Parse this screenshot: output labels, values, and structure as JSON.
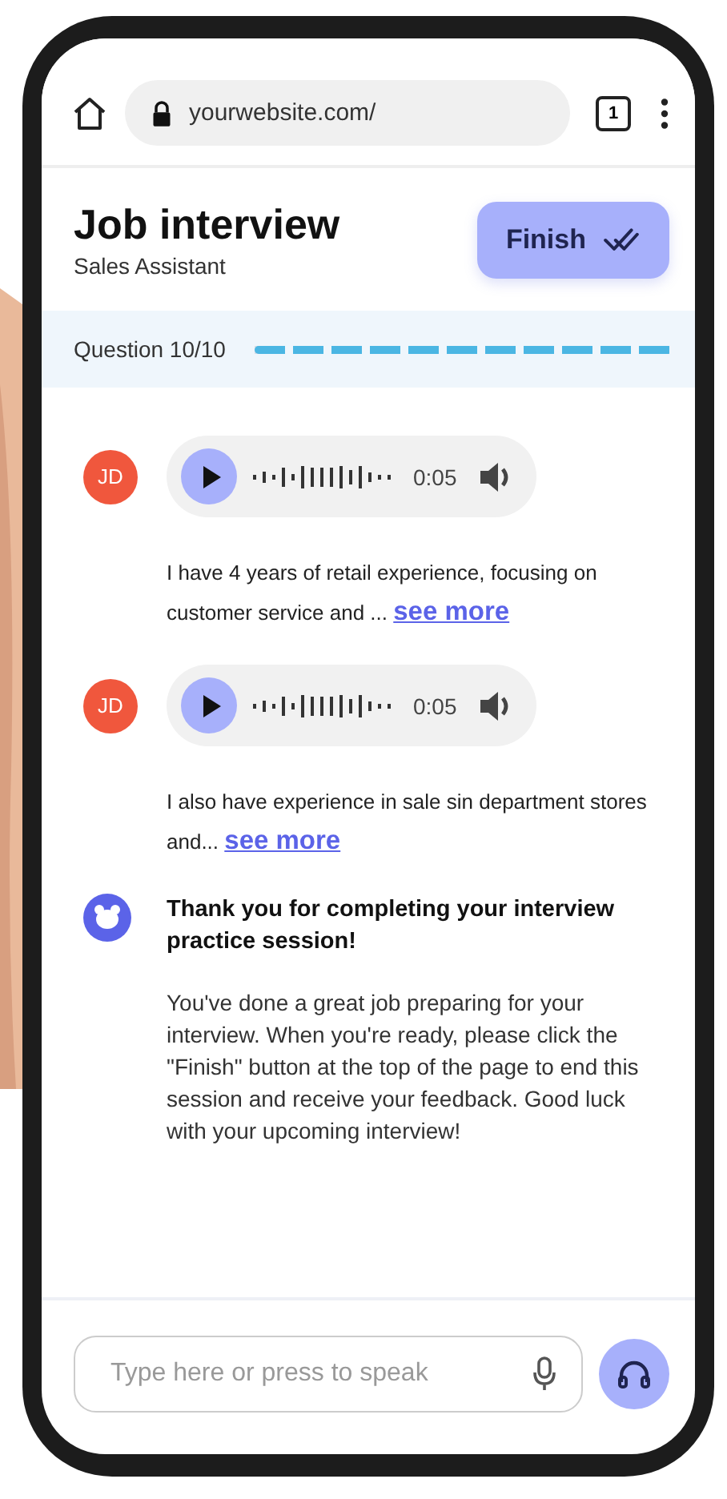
{
  "browser": {
    "url": "yourwebsite.com/",
    "tab_count": "1"
  },
  "header": {
    "title": "Job interview",
    "subtitle": "Sales Assistant",
    "finish_button": "Finish"
  },
  "progress": {
    "label": "Question 10/10",
    "level": 1
  },
  "messages": [
    {
      "kind": "audio",
      "initials": "JD",
      "color": "#f0573d",
      "duration": "0:05",
      "text": "I have 4 years of retail experience, focusing on customer service and ...",
      "link": "see more"
    },
    {
      "kind": "audio",
      "initials": "JD",
      "color": "#f0573d",
      "duration": "0:05",
      "text": "I also have experience in sale sin department stores and...",
      "link": "see more"
    },
    {
      "kind": "bot",
      "title": "Thank you for completing your interview practice session!",
      "text": "You've done a great job preparing for your interview. When you're ready, please click the \"Finish\" button at the top of the page to end this session and receive your feedback. Good luck with your upcoming interview!"
    }
  ],
  "input": {
    "placeholder": "Type here or press to speak"
  }
}
